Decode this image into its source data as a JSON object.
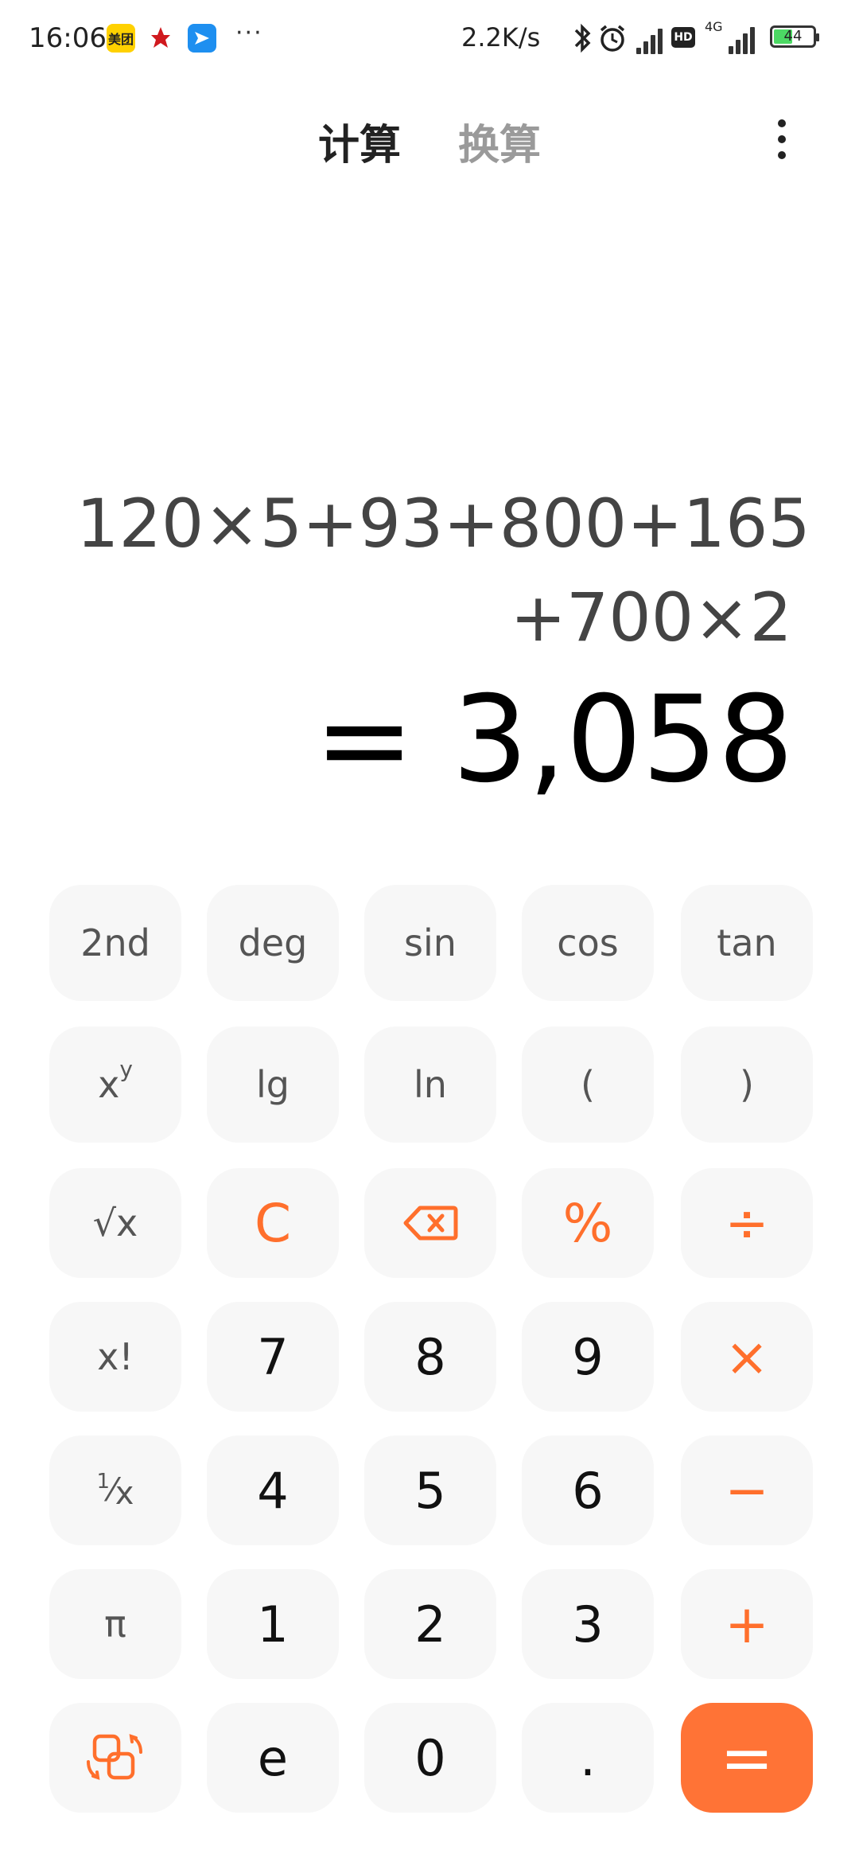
{
  "status_bar": {
    "time": "16:06",
    "meituan_label": "美团",
    "more": "···",
    "net_speed": "2.2K/s",
    "hd": "HD",
    "network": "4G",
    "battery": "44"
  },
  "tabs": {
    "calculate": "计算",
    "convert": "换算"
  },
  "display": {
    "expression_line1": "120×5+93+800+165",
    "expression_line2": "+700×2",
    "result": "= 3,058"
  },
  "keys": {
    "second": "2nd",
    "deg": "deg",
    "sin": "sin",
    "cos": "cos",
    "tan": "tan",
    "pow_base": "x",
    "pow_exp": "y",
    "lg": "lg",
    "ln": "ln",
    "lparen": "(",
    "rparen": ")",
    "sqrt": "√x",
    "clear": "C",
    "percent": "%",
    "divide": "÷",
    "factorial": "x!",
    "seven": "7",
    "eight": "8",
    "nine": "9",
    "multiply": "×",
    "recip_num": "1",
    "recip_den": "x",
    "four": "4",
    "five": "5",
    "six": "6",
    "minus": "−",
    "pi": "π",
    "one": "1",
    "two": "2",
    "three": "3",
    "plus": "+",
    "e": "e",
    "zero": "0",
    "dot": ".",
    "equals": "="
  },
  "colors": {
    "accent": "#ff6f2c",
    "equals_bg": "#ff7336",
    "key_bg": "#f7f7f7"
  }
}
